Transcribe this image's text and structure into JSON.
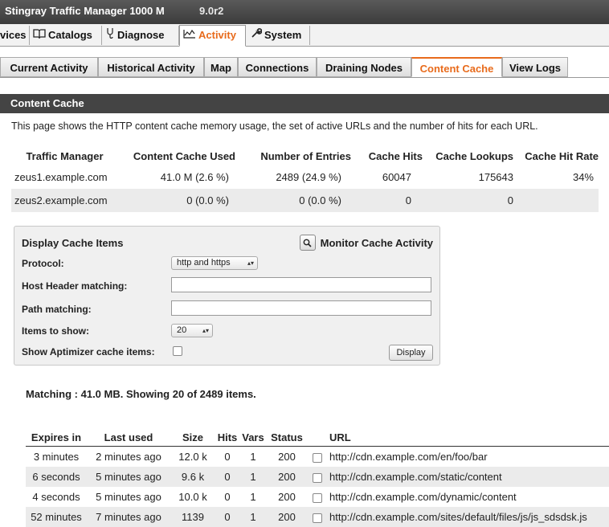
{
  "title": {
    "product": "Stingray Traffic Manager  1000 M",
    "version": "9.0r2"
  },
  "main_tabs": [
    {
      "label": "vices",
      "icon": ""
    },
    {
      "label": "Catalogs",
      "icon": "book-icon"
    },
    {
      "label": "Diagnose",
      "icon": "stethoscope-icon"
    },
    {
      "label": "Activity",
      "icon": "chart-icon"
    },
    {
      "label": "System",
      "icon": "wrench-icon"
    }
  ],
  "sub_tabs": [
    "Current Activity",
    "Historical Activity",
    "Map",
    "Connections",
    "Draining Nodes",
    "Content Cache",
    "View Logs"
  ],
  "section_title": "Content Cache",
  "intro": "This page shows the HTTP content cache memory usage, the set of active URLs and the number of hits for each URL.",
  "stats": {
    "headers": [
      "Traffic Manager",
      "Content Cache Used",
      "Number of Entries",
      "Cache Hits",
      "Cache Lookups",
      "Cache Hit Rate"
    ],
    "rows": [
      [
        "zeus1.example.com",
        "41.0 M (2.6 %)",
        "2489 (24.9 %)",
        "60047",
        "175643",
        "34%"
      ],
      [
        "zeus2.example.com",
        "0 (0.0 %)",
        "0 (0.0 %)",
        "0",
        "0",
        ""
      ]
    ]
  },
  "panel": {
    "title": "Display Cache Items",
    "monitor_label": "Monitor Cache Activity",
    "protocol_label": "Protocol:",
    "protocol_value": "http and https",
    "host_label": "Host Header matching:",
    "host_value": "",
    "path_label": "Path matching:",
    "path_value": "",
    "items_label": "Items to show:",
    "items_value": "20",
    "aptimizer_label": "Show Aptimizer cache items:",
    "display_button": "Display"
  },
  "matching_text": "Matching : 41.0 MB.  Showing 20 of 2489 items.",
  "items": {
    "headers": [
      "Expires in",
      "Last used",
      "Size",
      "Hits",
      "Vars",
      "Status",
      "",
      "URL"
    ],
    "rows": [
      [
        "3 minutes",
        "2 minutes ago",
        "12.0 k",
        "0",
        "1",
        "200",
        "",
        "http://cdn.example.com/en/foo/bar"
      ],
      [
        "6 seconds",
        "5 minutes ago",
        "9.6 k",
        "0",
        "1",
        "200",
        "",
        "http://cdn.example.com/static/content"
      ],
      [
        "4 seconds",
        "5 minutes ago",
        "10.0 k",
        "0",
        "1",
        "200",
        "",
        "http://cdn.example.com/dynamic/content"
      ],
      [
        "52 minutes",
        "7 minutes ago",
        "1139",
        "0",
        "1",
        "200",
        "",
        "http://cdn.example.com/sites/default/files/js/js_sdsdsk.js"
      ]
    ]
  }
}
